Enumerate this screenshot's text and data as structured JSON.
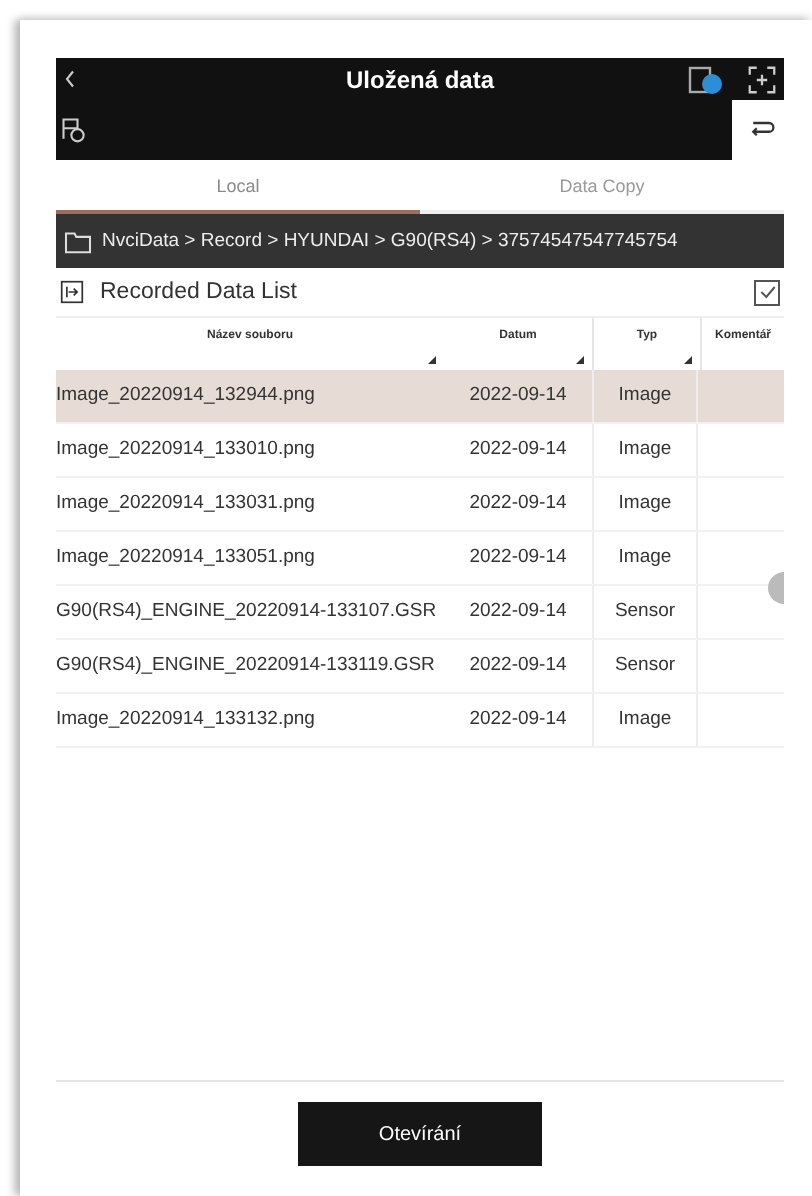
{
  "window": {
    "title": "Uložená data"
  },
  "tabs": [
    {
      "label": "Local",
      "selected": true
    },
    {
      "label": "Data Copy",
      "selected": false
    }
  ],
  "path": "NvciData > Record > HYUNDAI > G90(RS4) > 37574547547745754",
  "list": {
    "title": "Recorded Data List",
    "checked": true
  },
  "table": {
    "columns": [
      "Název souboru",
      "Datum",
      "Typ",
      "Komentář"
    ],
    "rows": [
      {
        "name": "Image_20220914_132944.png",
        "date": "2022-09-14",
        "type": "Image",
        "selected": true
      },
      {
        "name": "Image_20220914_133010.png",
        "date": "2022-09-14",
        "type": "Image",
        "selected": false
      },
      {
        "name": "Image_20220914_133031.png",
        "date": "2022-09-14",
        "type": "Image",
        "selected": false
      },
      {
        "name": "Image_20220914_133051.png",
        "date": "2022-09-14",
        "type": "Image",
        "selected": false
      },
      {
        "name": "G90(RS4)_ENGINE_20220914-133107.GSR",
        "date": "2022-09-14",
        "type": "Sensor",
        "selected": false
      },
      {
        "name": "G90(RS4)_ENGINE_20220914-133119.GSR",
        "date": "2022-09-14",
        "type": "Sensor",
        "selected": false
      },
      {
        "name": "Image_20220914_133132.png",
        "date": "2022-09-14",
        "type": "Image",
        "selected": false
      }
    ]
  },
  "button": "Otevírání"
}
